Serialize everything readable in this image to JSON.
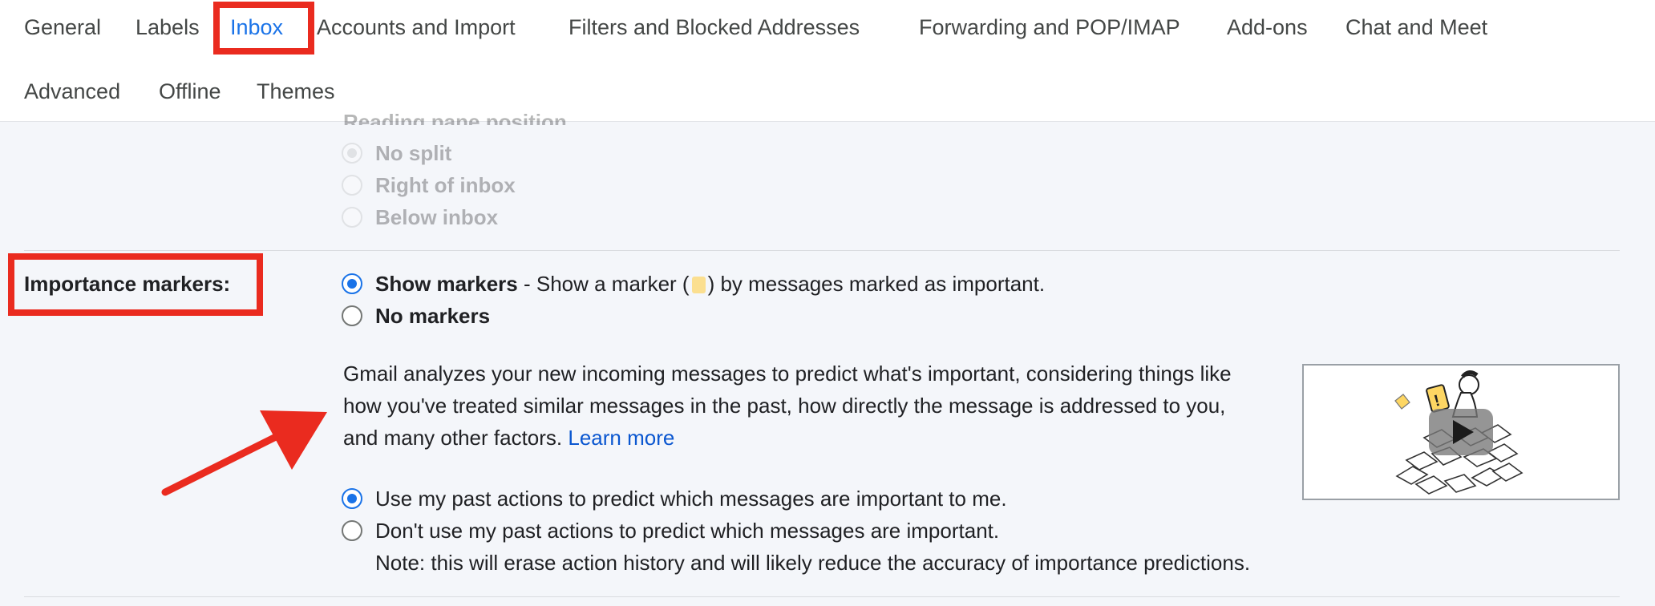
{
  "tabs": [
    {
      "label": "General",
      "active": false
    },
    {
      "label": "Labels",
      "active": false
    },
    {
      "label": "Inbox",
      "active": true
    },
    {
      "label": "Accounts and Import",
      "active": false
    },
    {
      "label": "Filters and Blocked Addresses",
      "active": false
    },
    {
      "label": "Forwarding and POP/IMAP",
      "active": false
    },
    {
      "label": "Add-ons",
      "active": false
    },
    {
      "label": "Chat and Meet",
      "active": false
    },
    {
      "label": "Advanced",
      "active": false
    },
    {
      "label": "Offline",
      "active": false
    },
    {
      "label": "Themes",
      "active": false
    }
  ],
  "reading_pane": {
    "title": "Reading pane position",
    "options": [
      {
        "label": "No split",
        "selected": true
      },
      {
        "label": "Right of inbox",
        "selected": false
      },
      {
        "label": "Below inbox",
        "selected": false
      }
    ]
  },
  "importance": {
    "label": "Importance markers:",
    "show_markers_bold": "Show markers",
    "show_markers_desc_before": " - Show a marker (",
    "show_markers_desc_after": ") by messages marked as important.",
    "show_markers_selected": true,
    "no_markers": "No markers",
    "no_markers_selected": false,
    "description": "Gmail analyzes your new incoming messages to predict what's important, considering things like how you've treated similar messages in the past, how directly the message is addressed to you, and many other factors.",
    "learn_more": "Learn more",
    "predict_options": [
      {
        "label": "Use my past actions to predict which messages are important to me.",
        "selected": true
      },
      {
        "label": "Don't use my past actions to predict which messages are important.",
        "selected": false
      }
    ],
    "note": "Note: this will erase action history and will likely reduce the accuracy of importance predictions."
  },
  "colors": {
    "accent": "#1a73e8",
    "link": "#0b57d0",
    "annotation_red": "#ea2b1f",
    "marker_yellow": "#fdd663"
  },
  "icons": [
    "play-icon",
    "importance-marker-icon",
    "arrow-annotation"
  ]
}
